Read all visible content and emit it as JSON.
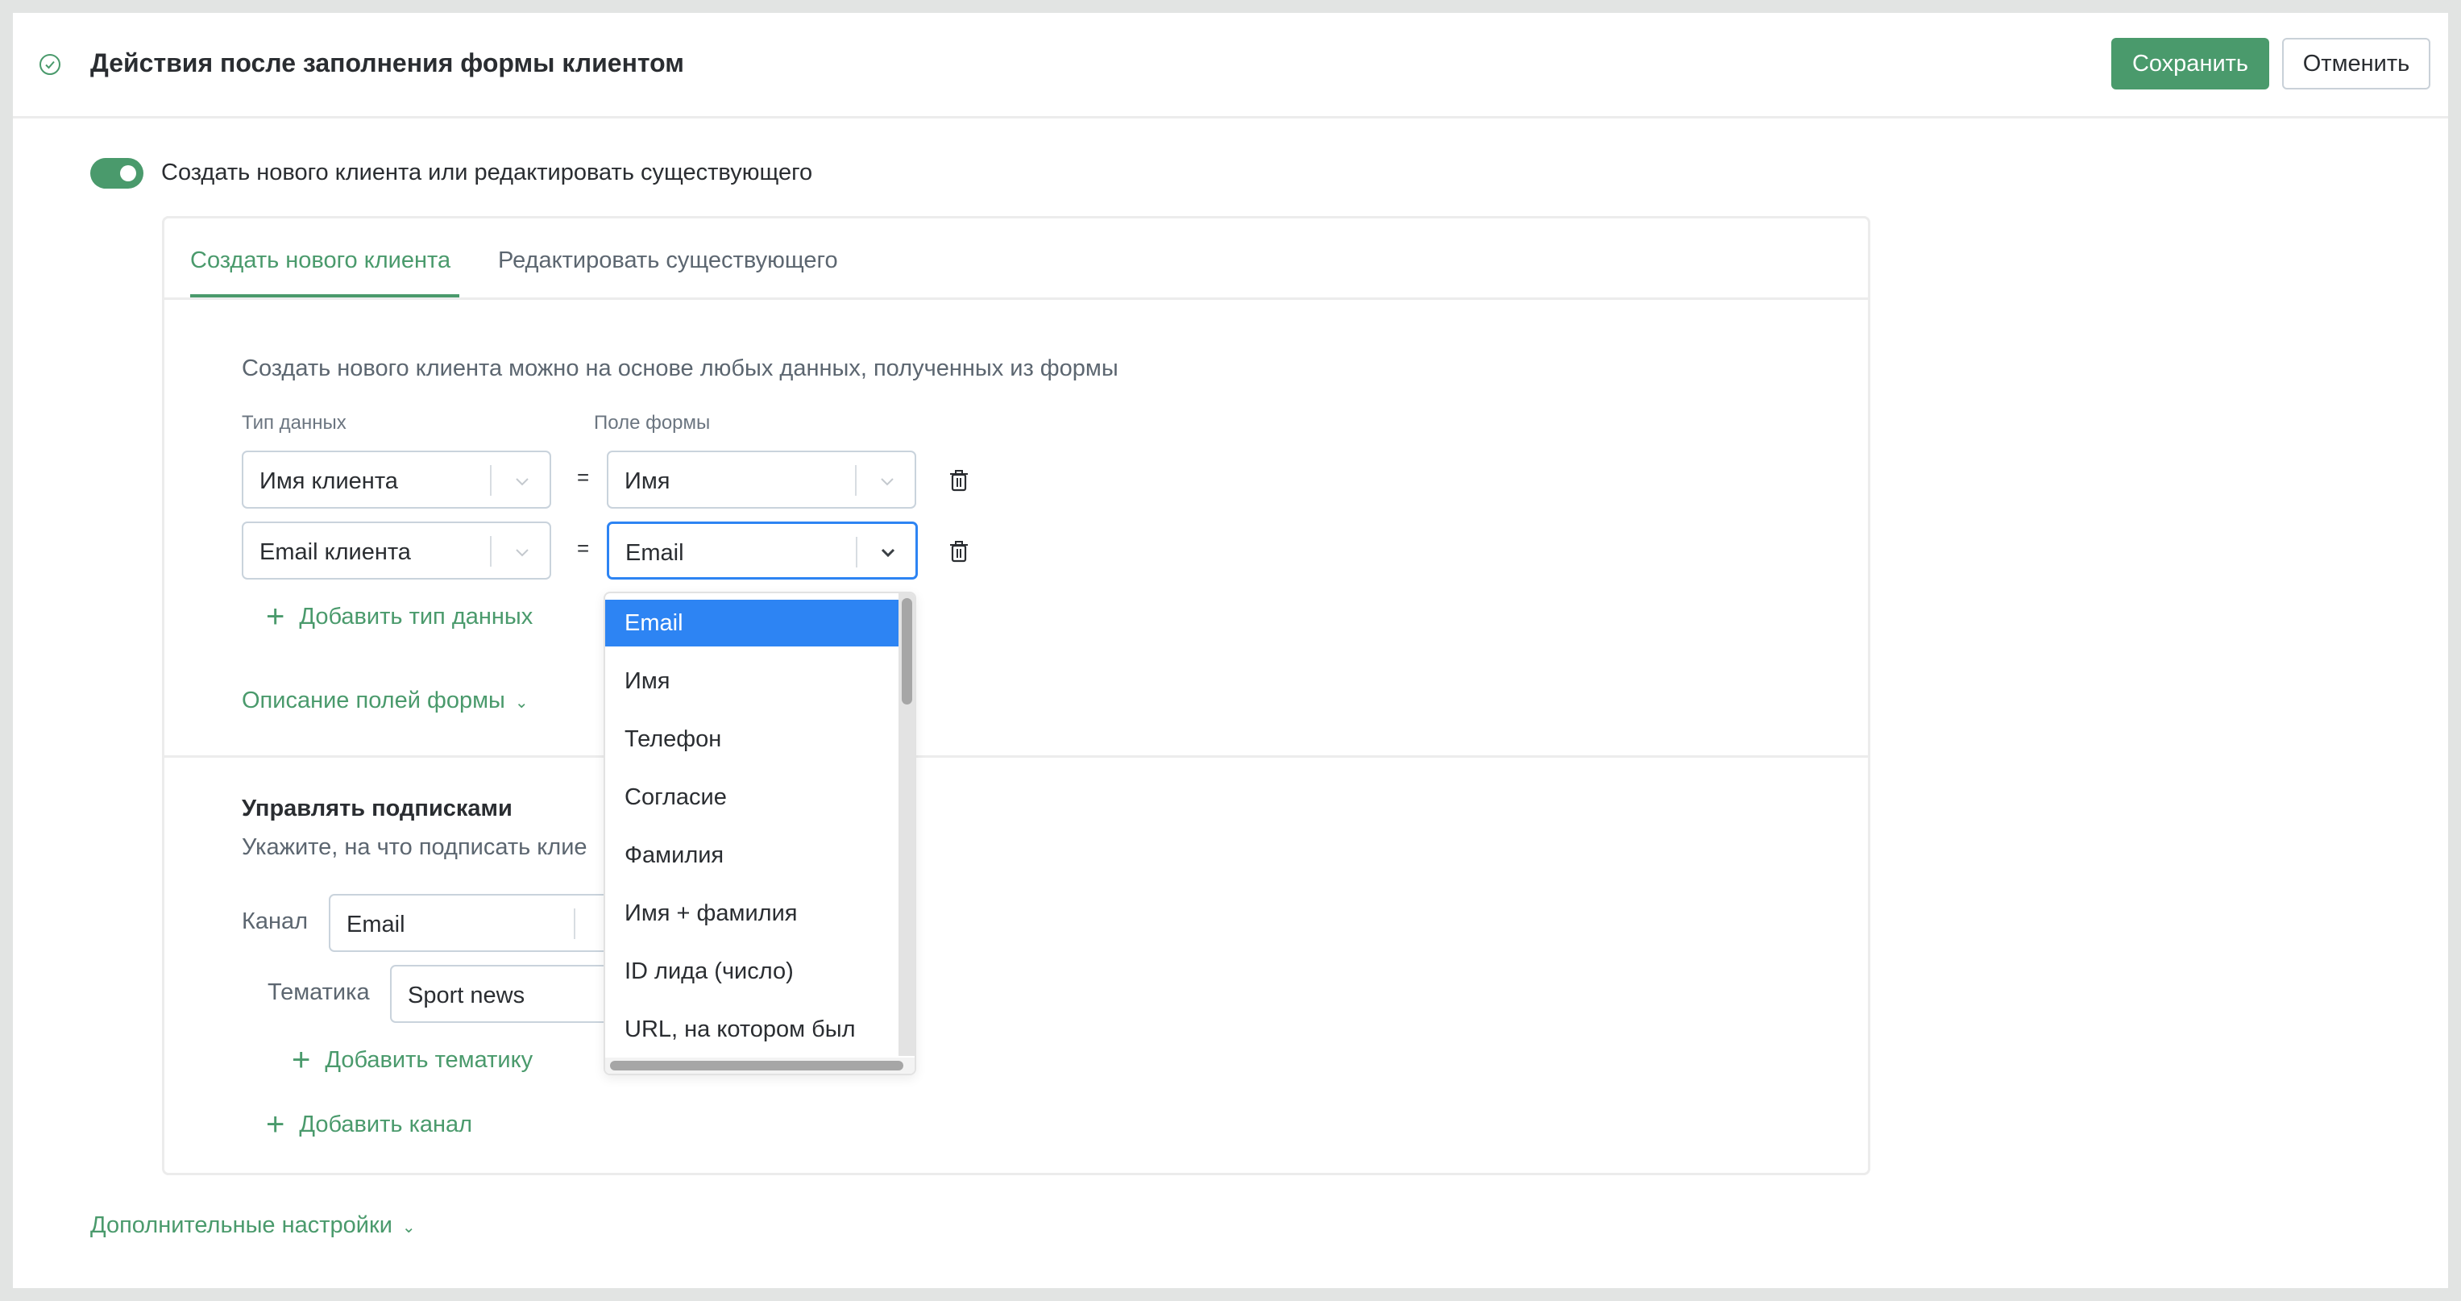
{
  "header": {
    "status_icon": "check-circle-icon",
    "title": "Действия после заполнения формы клиентом",
    "save_label": "Сохранить",
    "cancel_label": "Отменить"
  },
  "toggle": {
    "checked": true,
    "label": "Создать нового клиента или редактировать существующего"
  },
  "tabs": [
    {
      "label": "Создать нового клиента",
      "active": true
    },
    {
      "label": "Редактировать существующего",
      "active": false
    }
  ],
  "create": {
    "description": "Создать нового клиента можно на основе любых данных, полученных из формы",
    "col_data_type": "Тип данных",
    "col_form_field": "Поле формы",
    "equals": "=",
    "mappings": [
      {
        "data_type": "Имя клиента",
        "form_field": "Имя"
      },
      {
        "data_type": "Email клиента",
        "form_field": "Email"
      }
    ],
    "add_data_type": "Добавить тип данных",
    "form_fields_description": "Описание полей формы"
  },
  "subscriptions": {
    "title": "Управлять подписками",
    "description": "Укажите, на что подписать клие",
    "channel_label": "Канал",
    "channel_value": "Email",
    "topic_label": "Тематика",
    "topic_value": "Sport news",
    "add_topic": "Добавить тематику",
    "add_channel": "Добавить канал"
  },
  "dropdown": {
    "selected": "Email",
    "options": [
      "Email",
      "Имя",
      "Телефон",
      "Согласие",
      "Фамилия",
      "Имя + фамилия",
      "ID лида (число)",
      "URL, на котором был"
    ]
  },
  "advanced_settings": "Дополнительные настройки",
  "colors": {
    "accent": "#4a9a6c",
    "focus": "#2d84f3"
  }
}
